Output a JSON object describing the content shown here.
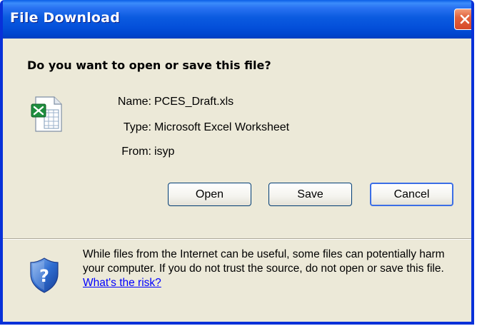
{
  "window": {
    "title": "File Download",
    "close_glyph": "✕"
  },
  "question": "Do you want to open or save this file?",
  "file": {
    "icon": "excel-file-icon",
    "name_label": "Name:",
    "name_value": "PCES_Draft.xls",
    "type_label": "Type:",
    "type_value": "Microsoft Excel Worksheet",
    "from_label": "From:",
    "from_value": "isyp"
  },
  "buttons": {
    "open": "Open",
    "save": "Save",
    "cancel": "Cancel"
  },
  "warning": {
    "icon": "security-shield-icon",
    "text": "While files from the Internet can be useful, some files can potentially harm your computer. If you do not trust the source, do not open or save this file.",
    "link": "What's the risk?"
  },
  "colors": {
    "titlebar": "#0450DA",
    "dialog_bg": "#ECE9D8",
    "close_button": "#E2623D",
    "link": "#0000FF"
  }
}
